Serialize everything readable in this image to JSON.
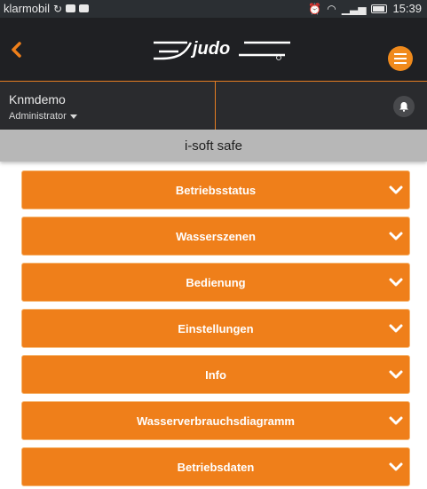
{
  "status_bar": {
    "carrier": "klarmobil",
    "time": "15:39"
  },
  "header": {
    "logo_text": "judo",
    "menu_icon": "hamburger-icon",
    "back_icon": "chevron-left-icon"
  },
  "user": {
    "name": "Knmdemo",
    "role": "Administrator",
    "notification_icon": "bell-icon"
  },
  "page": {
    "title": "i-soft safe"
  },
  "sections": [
    {
      "label": "Betriebsstatus"
    },
    {
      "label": "Wasserszenen"
    },
    {
      "label": "Bedienung"
    },
    {
      "label": "Einstellungen"
    },
    {
      "label": "Info"
    },
    {
      "label": "Wasserverbrauchsdiagramm"
    },
    {
      "label": "Betriebsdaten"
    }
  ],
  "colors": {
    "accent": "#ef7f1a",
    "header_bg": "#1f2023",
    "title_bar_bg": "#b7b7b7"
  }
}
